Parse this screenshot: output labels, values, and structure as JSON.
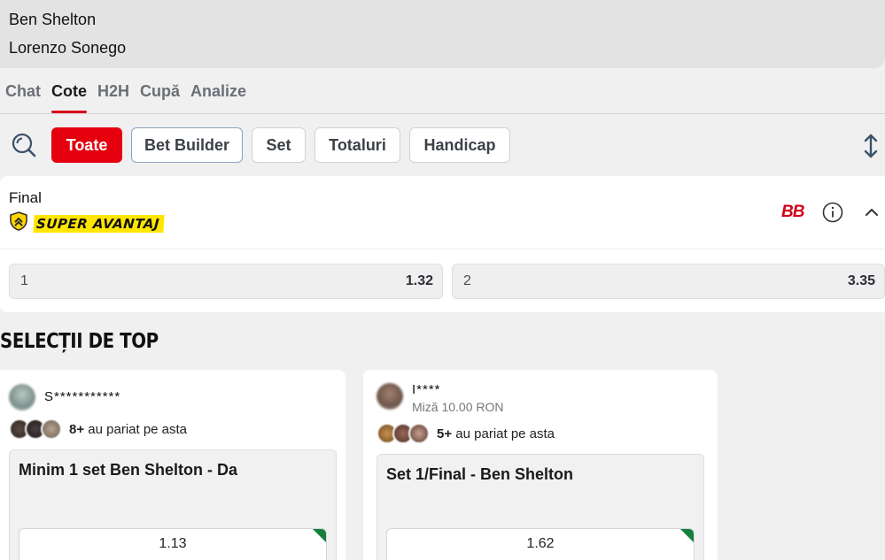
{
  "match": {
    "player1": "Ben Shelton",
    "player2": "Lorenzo Sonego"
  },
  "tabs": [
    "Chat",
    "Cote",
    "H2H",
    "Cupă",
    "Analize"
  ],
  "active_tab": "Cote",
  "filters": {
    "all": "Toate",
    "bet_builder": "Bet Builder",
    "set": "Set",
    "totals": "Totaluri",
    "handicap": "Handicap"
  },
  "market": {
    "title": "Final",
    "badge": "SUPER AVANTAJ",
    "bb_label": "BB",
    "odds": [
      {
        "label": "1",
        "value": "1.32"
      },
      {
        "label": "2",
        "value": "3.35"
      }
    ]
  },
  "top_selections": {
    "title": "SELECȚII DE TOP",
    "cards": [
      {
        "user": "S***********",
        "stake": "",
        "bettors_count": "8+",
        "bettors_text": "au pariat pe asta",
        "selection": "Minim 1 set Ben Shelton - Da",
        "odd": "1.13"
      },
      {
        "user": "I****",
        "stake": "Miză 10.00 RON",
        "bettors_count": "5+",
        "bettors_text": "au pariat pe asta",
        "selection": "Set 1/Final - Ben Shelton",
        "odd": "1.62"
      }
    ]
  },
  "colors": {
    "accent": "#e6000f",
    "badge_yellow": "#ffe600",
    "green_flag": "#14803c"
  },
  "icons": [
    "search-icon",
    "sort-icon",
    "shield-icon",
    "info-icon",
    "chevron-up-icon"
  ]
}
